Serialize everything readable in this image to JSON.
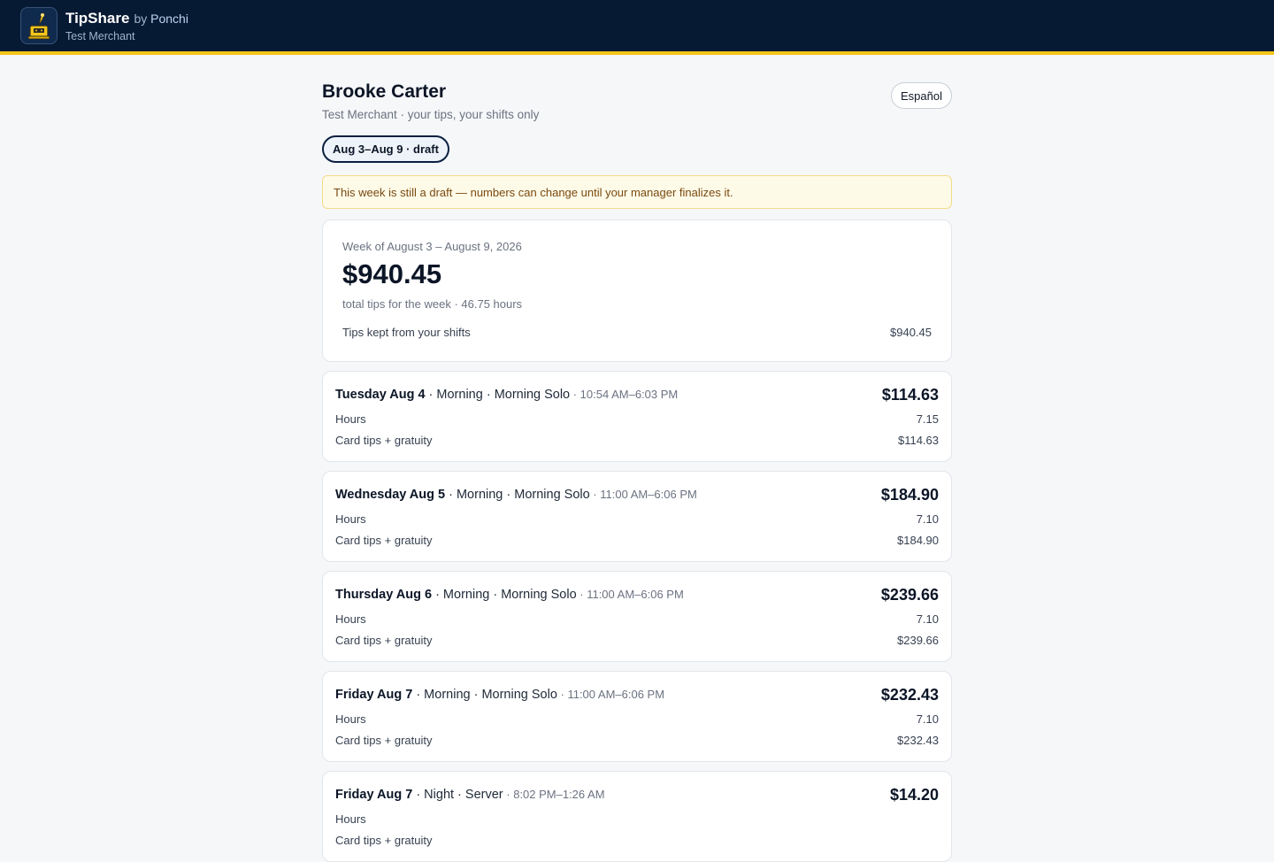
{
  "header": {
    "app_name": "TipShare",
    "by_prefix": "by",
    "by_name": "Ponchi",
    "merchant": "Test Merchant",
    "logo_icon": "tip-jar-register-icon",
    "colors": {
      "bar": "#071a33",
      "accent": "#f5c518"
    }
  },
  "employee": {
    "name": "Brooke Carter",
    "subtitle": "Test Merchant · your tips, your shifts only"
  },
  "language_button": "Español",
  "week_chip": "Aug 3–Aug 9 · draft",
  "draft_notice": "This week is still a draft — numbers can change until your manager finalizes it.",
  "summary": {
    "week_label": "Week of August 3 – August 9, 2026",
    "total": "$940.45",
    "meta": "total tips for the week · 46.75 hours",
    "line_label": "Tips kept from your shifts",
    "line_value": "$940.45"
  },
  "shifts": [
    {
      "day": "Tuesday Aug 4",
      "details": " · Morning · Morning Solo",
      "time": " · 10:54 AM–6:03 PM",
      "amount": "$114.63",
      "hours_label": "Hours",
      "hours": "7.15",
      "tips_label": "Card tips + gratuity",
      "tips": "$114.63"
    },
    {
      "day": "Wednesday Aug 5",
      "details": " · Morning · Morning Solo",
      "time": " · 11:00 AM–6:06 PM",
      "amount": "$184.90",
      "hours_label": "Hours",
      "hours": "7.10",
      "tips_label": "Card tips + gratuity",
      "tips": "$184.90"
    },
    {
      "day": "Thursday Aug 6",
      "details": " · Morning · Morning Solo",
      "time": " · 11:00 AM–6:06 PM",
      "amount": "$239.66",
      "hours_label": "Hours",
      "hours": "7.10",
      "tips_label": "Card tips + gratuity",
      "tips": "$239.66"
    },
    {
      "day": "Friday Aug 7",
      "details": " · Morning · Morning Solo",
      "time": " · 11:00 AM–6:06 PM",
      "amount": "$232.43",
      "hours_label": "Hours",
      "hours": "7.10",
      "tips_label": "Card tips + gratuity",
      "tips": "$232.43"
    },
    {
      "day": "Friday Aug 7",
      "details": " · Night · Server",
      "time": " · 8:02 PM–1:26 AM",
      "amount": "$14.20",
      "hours_label": "Hours",
      "hours": "",
      "tips_label": "Card tips + gratuity",
      "tips": ""
    }
  ]
}
